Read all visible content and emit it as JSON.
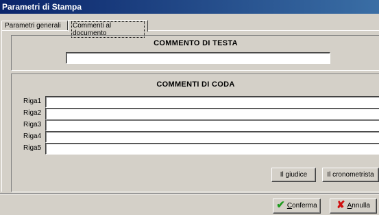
{
  "window": {
    "title": "Parametri di Stampa"
  },
  "tabs": [
    {
      "label": "Parametri generali",
      "active": false
    },
    {
      "label": "Commenti al documento",
      "active": true
    }
  ],
  "head_section": {
    "title": "COMMENTO DI TESTA",
    "value": ""
  },
  "tail_section": {
    "title": "COMMENTI DI CODA",
    "rows": [
      {
        "label": "Riga1",
        "value": ""
      },
      {
        "label": "Riga2",
        "value": ""
      },
      {
        "label": "Riga3",
        "value": ""
      },
      {
        "label": "Riga4",
        "value": ""
      },
      {
        "label": "Riga5",
        "value": ""
      }
    ],
    "buttons": {
      "judge_label": "Il giudice",
      "timekeeper_label": "Il cronometrista"
    }
  },
  "footer": {
    "confirm": {
      "accel": "C",
      "rest": "onferma",
      "icon": "check-icon"
    },
    "cancel": {
      "accel": "A",
      "rest": "nnulla",
      "icon": "x-icon"
    }
  },
  "colors": {
    "titlebar_start": "#0a246a",
    "titlebar_end": "#3a6ea5",
    "face": "#d4d0c8",
    "confirm_icon": "#1c9a1c",
    "cancel_icon": "#d01010"
  }
}
